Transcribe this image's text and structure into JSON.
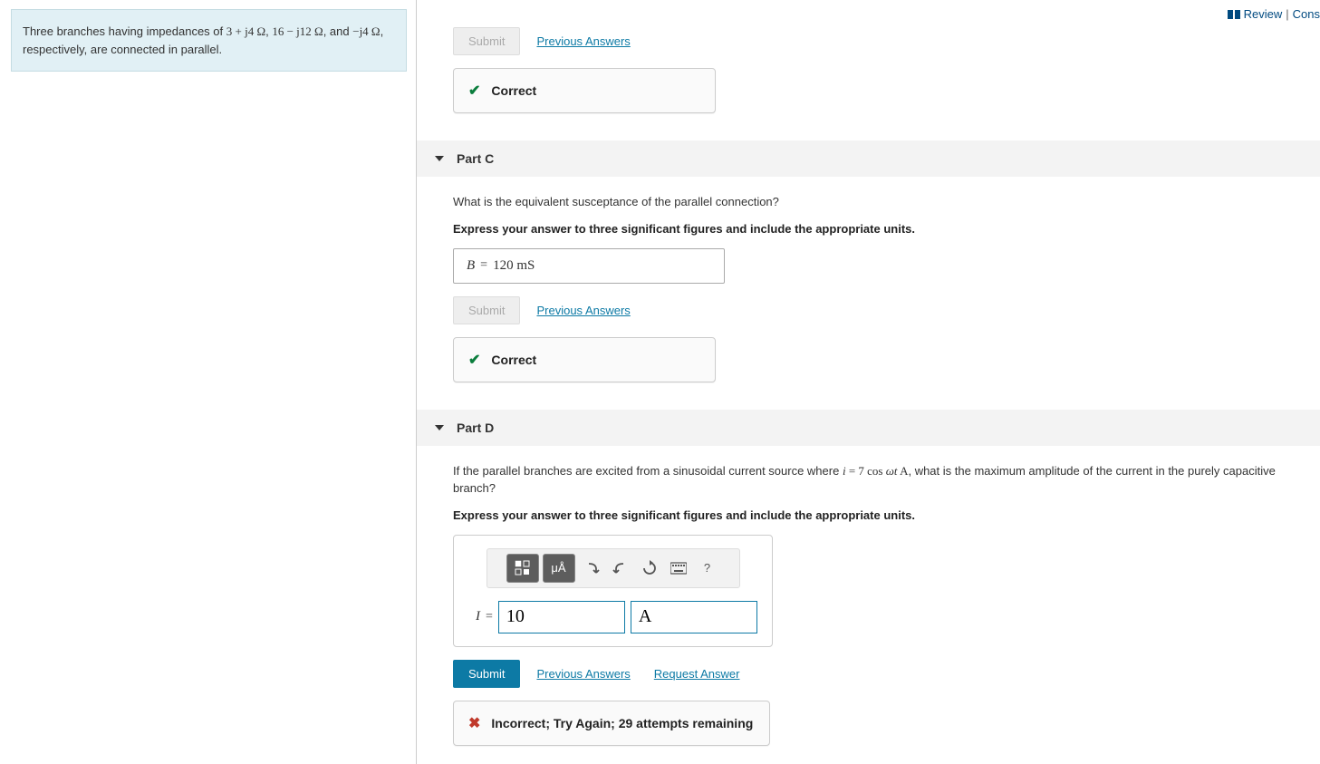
{
  "top": {
    "review": "Review",
    "constants": "Cons"
  },
  "problem": {
    "text_pre": "Three branches having impedances of ",
    "imp1": "3 + j4 Ω",
    "sep1": ", ",
    "imp2": "16 − j12 Ω",
    "sep2": ", and ",
    "imp3": "−j4 Ω",
    "text_post": ", respectively, are connected in parallel."
  },
  "partB": {
    "submit": "Submit",
    "prev": "Previous Answers",
    "feedback": "Correct"
  },
  "partC": {
    "title": "Part C",
    "question": "What is the equivalent susceptance of the parallel connection?",
    "instruction": "Express your answer to three significant figures and include the appropriate units.",
    "var": "B",
    "eq": "=",
    "value": "120 mS",
    "submit": "Submit",
    "prev": "Previous Answers",
    "feedback": "Correct"
  },
  "partD": {
    "title": "Part D",
    "q_pre": "If the parallel branches are excited from a sinusoidal current source where ",
    "q_eq": "i = 7 cos ωt A",
    "q_post": ", what is the maximum amplitude of the current in the purely capacitive branch?",
    "instruction": "Express your answer to three significant figures and include the appropriate units.",
    "toolbar": {
      "units_btn": "μÅ",
      "help": "?"
    },
    "var": "I",
    "eq": "=",
    "value": "10",
    "unit": "A",
    "submit": "Submit",
    "prev": "Previous Answers",
    "req": "Request Answer",
    "feedback": "Incorrect; Try Again; 29 attempts remaining"
  }
}
